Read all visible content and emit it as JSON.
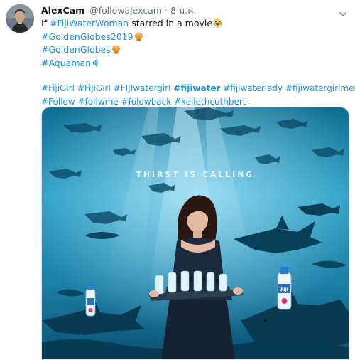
{
  "tweet": {
    "author_name": "AlexCam",
    "handle": "@followalexcam",
    "separator": "·",
    "time": "8 ม.ค.",
    "line1_pre": "If ",
    "line1_tag": "#FijiWaterWoman",
    "line1_post": " starred in a movie",
    "tags_lines": [
      "#GoldenGlobes2019",
      "#GoldenGlobes",
      "#Aquaman"
    ],
    "emoji": [
      "laughing-tears-emoji",
      "golden-globe-emoji",
      "golden-globe-emoji",
      "water-drop-emoji"
    ],
    "hashtags_row1": [
      "#FijiGirl",
      "#FijiGirl",
      "#FIJIwatergirl",
      "#fijiwater",
      "#fijiwaterlady",
      "#fijiwatergirlmeme"
    ],
    "hashtags_row2": [
      "#Follow",
      "#follwme",
      "#folowback",
      "#kelleth​cuthbert"
    ],
    "bold_tag_index": 3
  },
  "media": {
    "poster_text": "THIRST IS CALLING",
    "bottle_brand": "FIJI"
  },
  "colors": {
    "link": "#1b95e0",
    "muted": "#657786",
    "text": "#14171a",
    "water_deep": "#0a4f72",
    "water_light": "#3fb8dc"
  }
}
